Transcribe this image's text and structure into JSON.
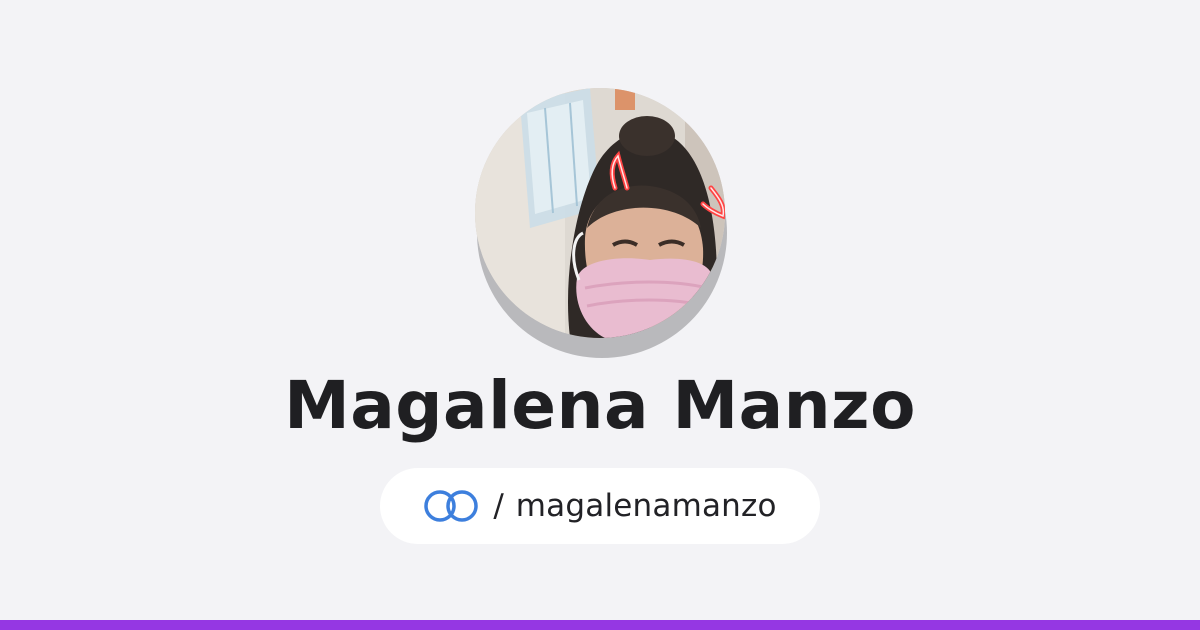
{
  "profile": {
    "name": "Magalena Manzo",
    "handle_separator": "/",
    "username": "magalenamanzo",
    "avatar_icon": "profile-photo",
    "link_icon": "linked-rings-icon"
  },
  "colors": {
    "background": "#f3f3f6",
    "name_text": "#1f1f22",
    "pill_background": "#ffffff",
    "link_icon": "#3d7fdd",
    "brand_bar": "#9537e3"
  }
}
